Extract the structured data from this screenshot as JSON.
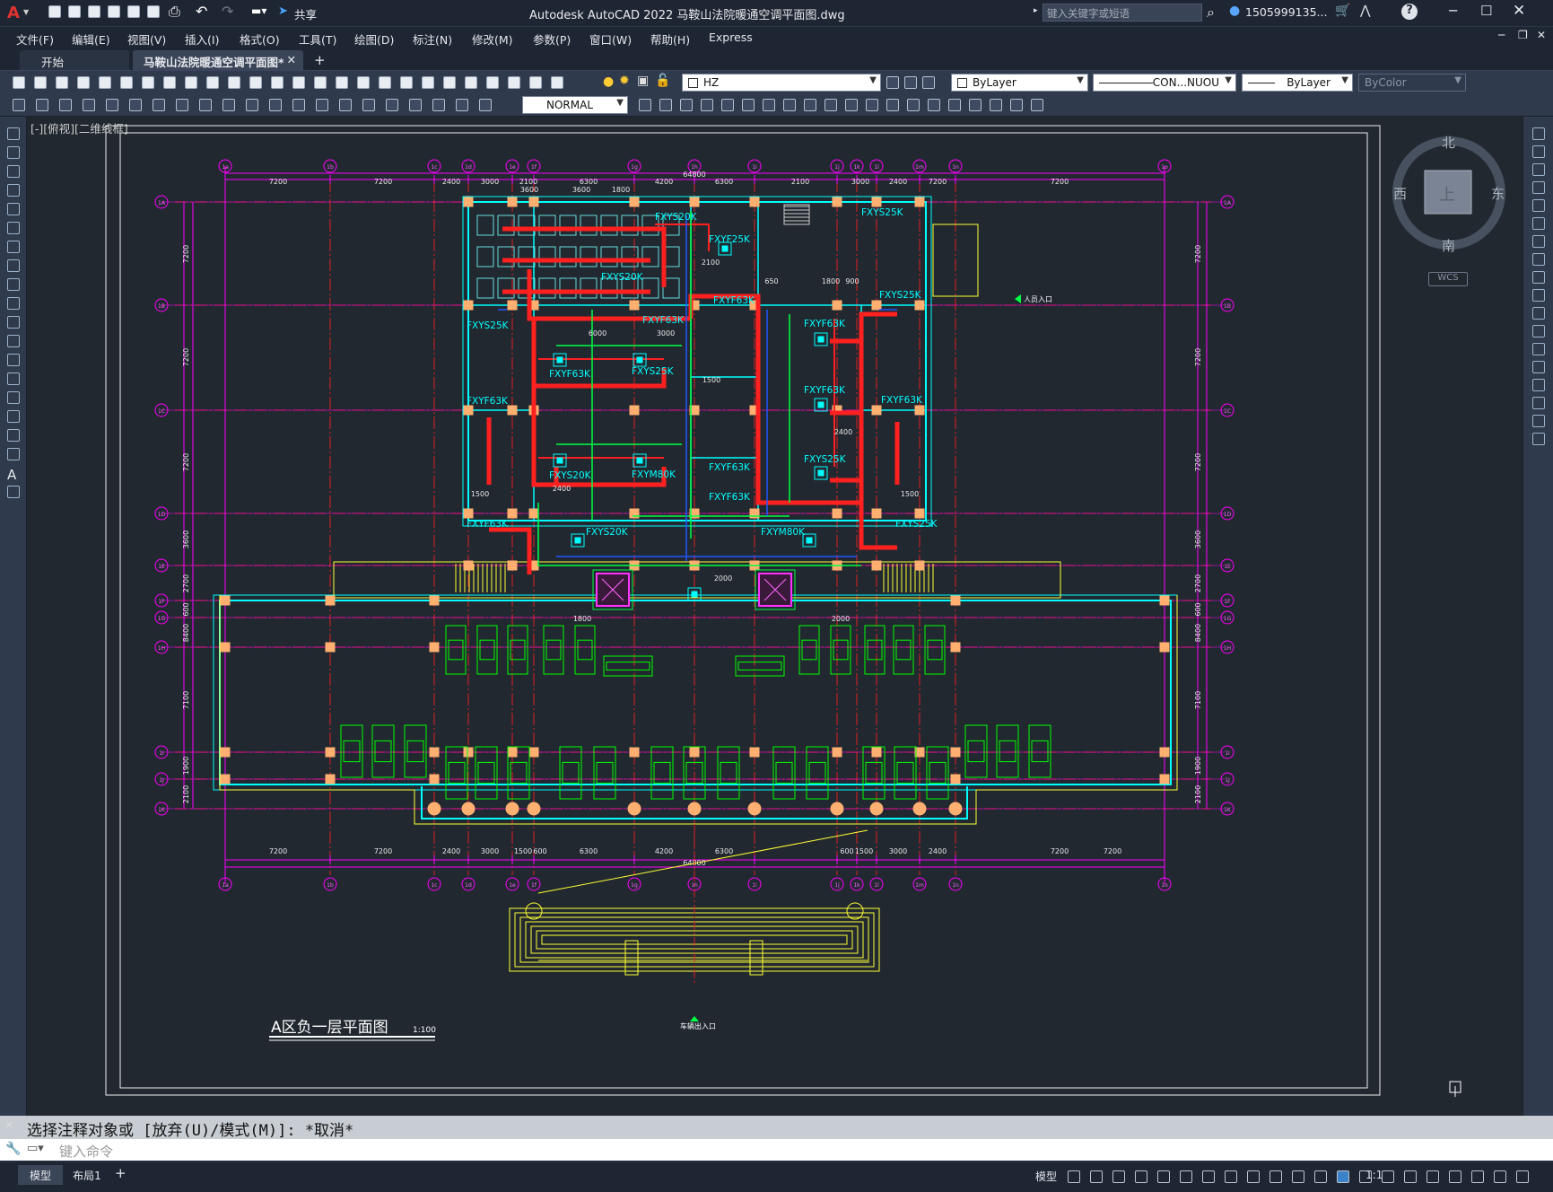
{
  "app": {
    "logo": "A",
    "title": "Autodesk AutoCAD 2022    马鞍山法院暖通空调平面图.dwg",
    "share_label": "共享",
    "search_placeholder": "键入关键字或短语",
    "user": "1505999135...",
    "help_icon": "?",
    "window_controls": [
      "minimize-icon",
      "maximize-icon",
      "close-icon"
    ]
  },
  "menu": [
    "文件(F)",
    "编辑(E)",
    "视图(V)",
    "插入(I)",
    "格式(O)",
    "工具(T)",
    "绘图(D)",
    "标注(N)",
    "修改(M)",
    "参数(P)",
    "窗口(W)",
    "帮助(H)",
    "Express"
  ],
  "tabs": [
    {
      "label": "开始",
      "active": false
    },
    {
      "label": "马鞍山法院暖通空调平面图*",
      "active": true
    }
  ],
  "toolbar": {
    "layer_combo": "HZ",
    "color_combo": "ByLayer",
    "linetype_combo": "CON...NUOU",
    "lineweight_combo": "ByLayer",
    "plotstyle_combo": "ByColor",
    "dimstyle_combo": "NORMAL"
  },
  "viewport_label": "[-][俯视][二维线框]",
  "viewcube": {
    "north": "北",
    "south": "南",
    "east": "东",
    "west": "西",
    "face": "上",
    "wcs": "WCS"
  },
  "drawing": {
    "title": "A区负一层平面图",
    "scale": "1:100",
    "top_dims": [
      "7200",
      "7200",
      "2400",
      "3000",
      "2100",
      "6300",
      "4200",
      "6300",
      "2100",
      "3000",
      "2400",
      "7200",
      "7200"
    ],
    "bottom_dims": [
      "7200",
      "7200",
      "2400",
      "3000",
      "1500",
      "600",
      "6300",
      "4200",
      "6300",
      "600",
      "1500",
      "3000",
      "2400",
      "7200",
      "7200"
    ],
    "overall_dim": "64800",
    "inner_dims": [
      "3600",
      "3600",
      "1800"
    ],
    "left_dims": [
      "7200",
      "7200",
      "7200",
      "3600",
      "2700",
      "600",
      "8400",
      "7100",
      "1900",
      "2100"
    ],
    "right_dims": [
      "7200",
      "7200",
      "7200",
      "3600",
      "2700",
      "600",
      "8400",
      "7100",
      "1900",
      "2100"
    ],
    "unit_labels": [
      "FXYS20K",
      "FXYF25K",
      "FXYS20K",
      "FXYS25K",
      "FXYS25K",
      "FXYS25K",
      "FXYF63K",
      "FXYF63K",
      "FXYF63K",
      "FXYF63K",
      "FXYS25K",
      "FXYS20K",
      "FXYM80K",
      "FXYF63K",
      "FXYF63K",
      "FXYF63K",
      "FXYS25K",
      "FXYF63K",
      "FXYF63K",
      "FXYF63K",
      "FXYS25K",
      "FXYS20K",
      "FXYM80K"
    ],
    "mid_dims": [
      "6000",
      "3000",
      "2100",
      "650",
      "1800",
      "900",
      "1500",
      "2400",
      "1500",
      "2400",
      "1500",
      "2000",
      "1800",
      "2000"
    ],
    "entrance_label": "人员入口",
    "vehicle_entrance": "车辆出入口"
  },
  "command": {
    "history": "选择注释对象或 [放弃(U)/模式(M)]: *取消*",
    "placeholder": "键入命令"
  },
  "layout_tabs": [
    "模型",
    "布局1"
  ],
  "status": {
    "model": "模型",
    "scale": "1:1"
  },
  "colors": {
    "grid": "#e02020",
    "axis": "#ff00ff",
    "wall": "#00ffff",
    "duct": "#ff2020",
    "car": "#00ff00",
    "stair": "#ffff00",
    "accent": "#d42c2c"
  }
}
